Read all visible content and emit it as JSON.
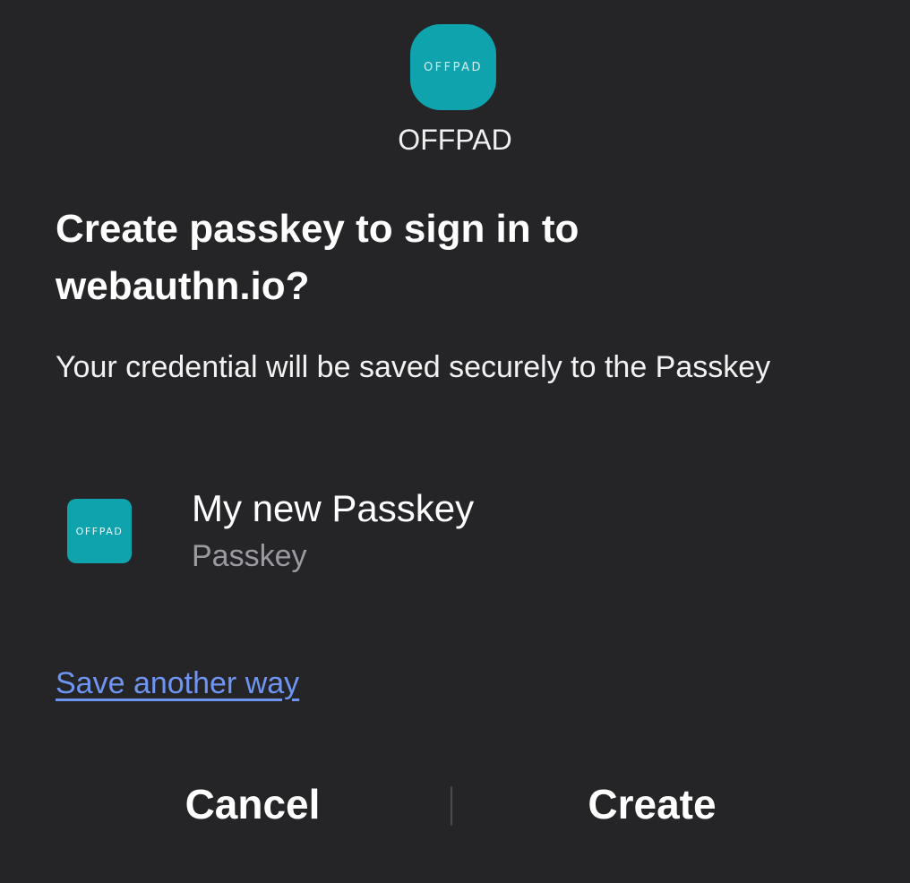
{
  "app": {
    "logo_text": "OFFPAD",
    "name": "OFFPAD",
    "accent_color": "#0fa3ad"
  },
  "dialog": {
    "title": "Create passkey to sign in to webauthn.io?",
    "description": "Your credential will be saved securely to the Passkey"
  },
  "account": {
    "icon_text": "OFFPAD",
    "name": "My new Passkey",
    "type": "Passkey"
  },
  "links": {
    "save_another_way": "Save another way",
    "link_color": "#6f95f2"
  },
  "actions": {
    "cancel_label": "Cancel",
    "create_label": "Create"
  }
}
